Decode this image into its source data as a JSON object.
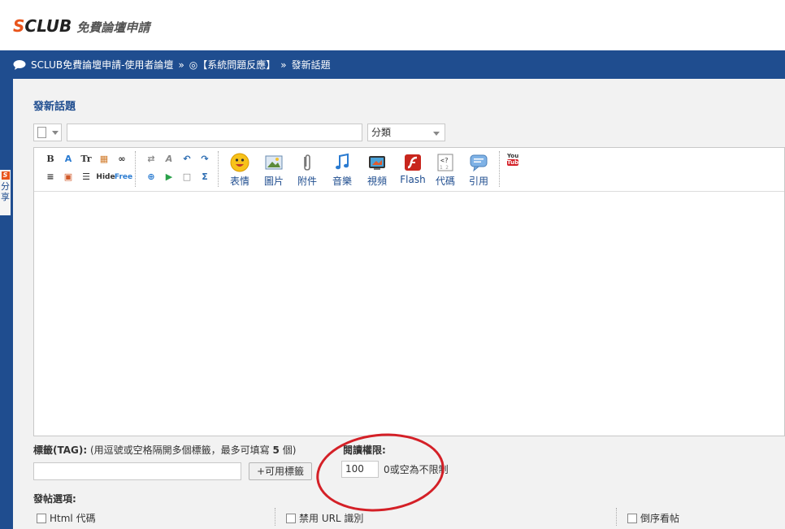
{
  "header": {
    "logo_brand_s": "S",
    "logo_brand_rest": "CLUB",
    "logo_tagline": "免費論壇申請"
  },
  "breadcrumb": {
    "forum": "SCLUB免費論壇申請-使用者論壇",
    "sep1": "»",
    "board_prefix": "◎【系統問題反應】",
    "sep2": "»",
    "current": "發新話題"
  },
  "sidebar": {
    "share_badge": "S",
    "share_char1": "分",
    "share_char2": "享"
  },
  "form": {
    "title": "發新話題",
    "subject_value": "",
    "category_selected": "分類"
  },
  "toolbar": {
    "small_buttons_row1": [
      "B",
      "A",
      "Tr",
      "▦",
      "∞",
      "⇄",
      "A",
      "↶",
      "↷"
    ],
    "small_buttons_row2": [
      "≡",
      "▣",
      "☰",
      "Hide",
      "Free",
      "⊕",
      "▶",
      "□",
      "Σ"
    ],
    "big_buttons": [
      {
        "label": "表情",
        "icon": "smiley-icon"
      },
      {
        "label": "圖片",
        "icon": "image-icon"
      },
      {
        "label": "附件",
        "icon": "paperclip-icon"
      },
      {
        "label": "音樂",
        "icon": "music-icon"
      },
      {
        "label": "視頻",
        "icon": "video-icon"
      },
      {
        "label": "Flash",
        "icon": "flash-icon"
      },
      {
        "label": "代碼",
        "icon": "code-icon"
      },
      {
        "label": "引用",
        "icon": "quote-icon"
      }
    ],
    "youtube_top": "You",
    "youtube_bottom": "Tube"
  },
  "tags": {
    "label_bold": "標籤(TAG):",
    "label_hint": "(用逗號或空格隔開多個標籤，最多可填寫",
    "label_max": "5",
    "label_end": "個)",
    "input_value": "",
    "button_label": "+可用標籤"
  },
  "permission": {
    "label": "閱讀權限:",
    "value": "100",
    "hint": "0或空為不限制"
  },
  "options": {
    "title": "發帖選項:",
    "items": [
      {
        "label": "Html 代碼",
        "checked": false
      },
      {
        "label": "禁用 URL 識別",
        "checked": false
      },
      {
        "label": "倒序看帖",
        "checked": false
      }
    ]
  },
  "colors": {
    "nav_blue": "#1f4d8f",
    "brand_orange": "#e8541b",
    "highlight_red": "#d42027"
  }
}
